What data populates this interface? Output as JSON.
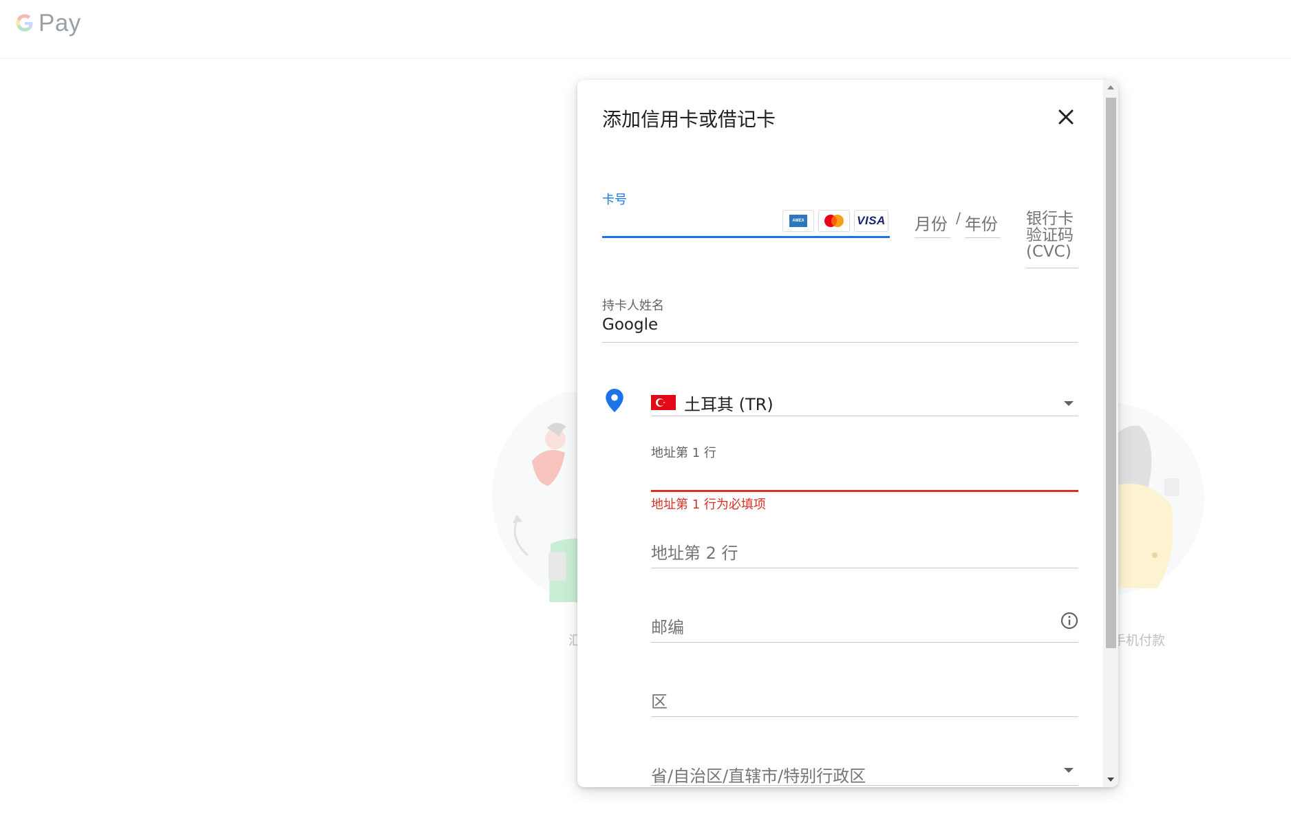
{
  "app": {
    "logo_text": "Pay"
  },
  "background": {
    "left_caption": "汇",
    "right_caption": "手机付款"
  },
  "dialog": {
    "title": "添加信用卡或借记卡",
    "close_icon": "close-icon",
    "card_number": {
      "label": "卡号",
      "value": "",
      "logos": [
        "amex",
        "mastercard",
        "visa"
      ],
      "visa_label": "VISA"
    },
    "expiry": {
      "month_placeholder": "月份",
      "separator": "/",
      "year_placeholder": "年份"
    },
    "cvc": {
      "placeholder": "银行卡验证码(CVC)"
    },
    "cardholder": {
      "label": "持卡人姓名",
      "value": "Google"
    },
    "address": {
      "country": "土耳其 (TR)",
      "line1_label": "地址第 1 行",
      "line1_value": "",
      "line1_error": "地址第 1 行为必填项",
      "line2_placeholder": "地址第 2 行",
      "postal_placeholder": "邮编",
      "district_placeholder": "区",
      "province_placeholder": "省/自治区/直辖市/特别行政区"
    }
  },
  "colors": {
    "accent": "#1a73e8",
    "error": "#d93025",
    "flag_red": "#e30a17"
  }
}
